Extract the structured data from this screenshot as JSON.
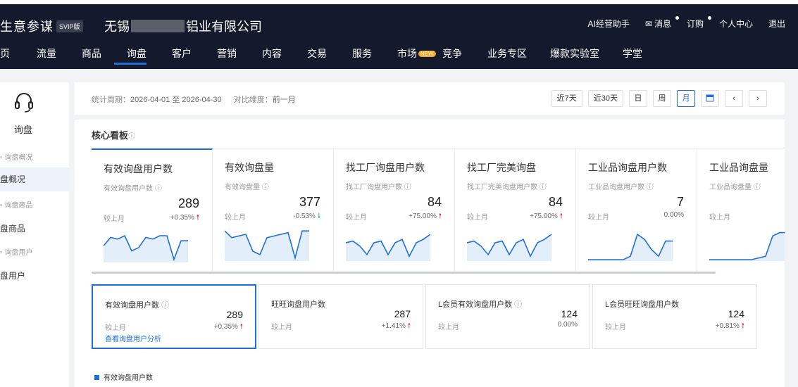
{
  "header": {
    "brand": "生意参谋",
    "badge": "SVIP版",
    "company_prefix": "无锡",
    "company_suffix": "铝业有限公司",
    "links": [
      "AI经营助手",
      "消息",
      "订购",
      "个人中心",
      "退出"
    ]
  },
  "nav": {
    "items": [
      "页",
      "流量",
      "商品",
      "询盘",
      "客户",
      "营销",
      "内容",
      "交易",
      "服务",
      "市场",
      "竞争",
      "业务专区",
      "爆款实验室",
      "学堂"
    ],
    "active": "询盘",
    "new_badge": "NEW"
  },
  "sidebar": {
    "title": "询盘",
    "items": [
      "询盘概况",
      "盘概况",
      "询盘商品",
      "盘商品",
      "询盘用户",
      "盘用户"
    ]
  },
  "filter": {
    "period_label": "统计周期：",
    "period_value": "2026-04-01 至 2026-04-30",
    "compare_label": "对比维度：",
    "compare_value": "前一月",
    "buttons": [
      "近7天",
      "近30天",
      "日",
      "周",
      "月"
    ],
    "active_button": "月",
    "calendar_icon": "calendar-icon",
    "prev_icon": "chevron-left-icon",
    "next_icon": "chevron-right-icon"
  },
  "core": {
    "title": "核心看板",
    "cards": [
      {
        "title": "有效询盘用户数",
        "sub": "有效询盘用户数",
        "value": "289",
        "cmp": "较上月",
        "pct": "+0.35%",
        "dir": "up",
        "trend": [
          0.55,
          0.3,
          0.35,
          0.25,
          0.7,
          0.6,
          0.3,
          0.35,
          0.25,
          0.25,
          0.95,
          0.4,
          0.4
        ]
      },
      {
        "title": "有效询盘量",
        "sub": "有效询盘量",
        "value": "377",
        "cmp": "较上月",
        "pct": "-0.53%",
        "dir": "down",
        "trend": [
          0.15,
          0.35,
          0.3,
          0.25,
          0.75,
          0.85,
          0.35,
          0.3,
          0.25,
          0.2,
          0.95,
          0.15,
          0.15
        ]
      },
      {
        "title": "找工厂询盘用户数",
        "sub": "找工厂询盘用户数",
        "value": "84",
        "cmp": "较上月",
        "pct": "+75.00%",
        "dir": "up",
        "trend": [
          0.5,
          0.45,
          0.6,
          0.85,
          0.5,
          0.45,
          0.85,
          0.5,
          0.4,
          0.9,
          0.5,
          0.4,
          0.25
        ]
      },
      {
        "title": "找工厂完美询盘",
        "sub": "找工厂完美询盘用户数",
        "value": "84",
        "cmp": "较上月",
        "pct": "+75.00%",
        "dir": "up",
        "trend": [
          0.5,
          0.45,
          0.6,
          0.85,
          0.5,
          0.45,
          0.85,
          0.5,
          0.4,
          0.9,
          0.5,
          0.4,
          0.25
        ]
      },
      {
        "title": "工业品询盘用户数",
        "sub": "工业品询盘用户数",
        "value": "7",
        "cmp": "较上月",
        "pct": "0.00%",
        "dir": "none",
        "trend": [
          1,
          1,
          1,
          1,
          1,
          1,
          0.9,
          0.25,
          0.4,
          0.7,
          0.9,
          0.45,
          0.45
        ]
      },
      {
        "title": "工业品询盘量",
        "sub": "工业品询盘量",
        "value": "",
        "cmp": "较上月",
        "pct": "",
        "dir": "none",
        "trend": [
          1,
          1,
          1,
          1,
          1,
          1,
          1,
          0.95,
          0.9,
          0.3,
          0.2,
          0.2,
          0.2
        ]
      }
    ],
    "sub_cards": [
      {
        "title": "有效询盘用户数",
        "value": "289",
        "cmp": "较上月",
        "pct": "+0.35%",
        "dir": "up",
        "link": "查看询盘用户分析"
      },
      {
        "title": "旺旺询盘用户数",
        "value": "287",
        "cmp": "较上月",
        "pct": "+1.41%",
        "dir": "up",
        "link": ""
      },
      {
        "title": "L会员有效询盘用户数",
        "value": "124",
        "cmp": "较上月",
        "pct": "0.00%",
        "dir": "none",
        "link": ""
      },
      {
        "title": "L会员旺旺询盘用户数",
        "value": "124",
        "cmp": "较上月",
        "pct": "+0.81%",
        "dir": "up",
        "link": ""
      }
    ],
    "legend": "有效询盘用户数"
  },
  "colors": {
    "accent": "#1e6fd9",
    "up": "#e02020",
    "down": "#19b26b",
    "header_bg": "#141a2b"
  }
}
